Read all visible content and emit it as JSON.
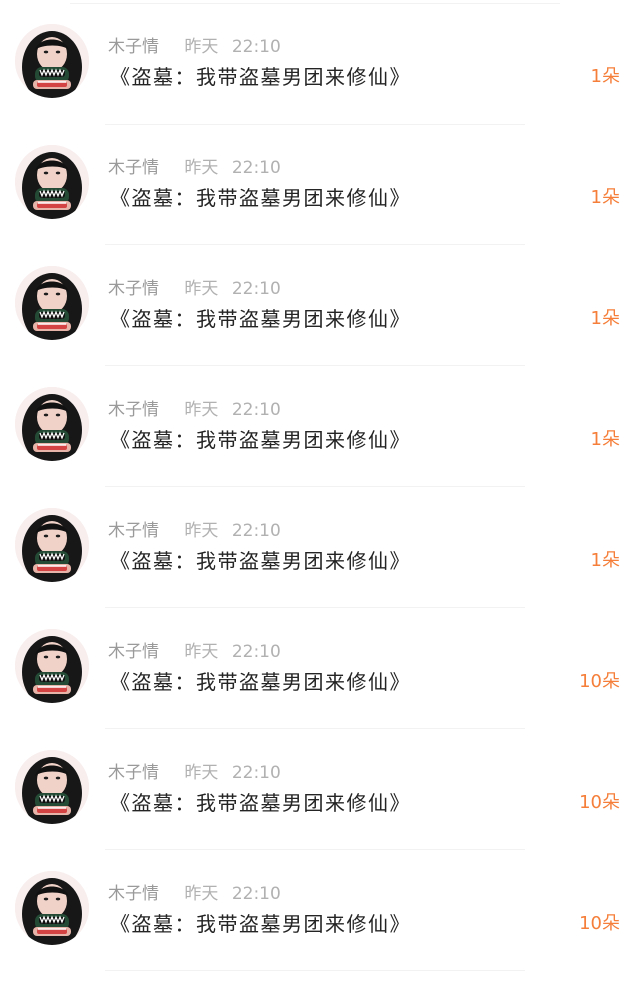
{
  "feed": {
    "items": [
      {
        "user": "木子情",
        "date": "昨天",
        "time": "22:10",
        "title": "《盗墓：我带盗墓男团来修仙》",
        "count": "1朵"
      },
      {
        "user": "木子情",
        "date": "昨天",
        "time": "22:10",
        "title": "《盗墓：我带盗墓男团来修仙》",
        "count": "1朵"
      },
      {
        "user": "木子情",
        "date": "昨天",
        "time": "22:10",
        "title": "《盗墓：我带盗墓男团来修仙》",
        "count": "1朵"
      },
      {
        "user": "木子情",
        "date": "昨天",
        "time": "22:10",
        "title": "《盗墓：我带盗墓男团来修仙》",
        "count": "1朵"
      },
      {
        "user": "木子情",
        "date": "昨天",
        "time": "22:10",
        "title": "《盗墓：我带盗墓男团来修仙》",
        "count": "1朵"
      },
      {
        "user": "木子情",
        "date": "昨天",
        "time": "22:10",
        "title": "《盗墓：我带盗墓男团来修仙》",
        "count": "10朵"
      },
      {
        "user": "木子情",
        "date": "昨天",
        "time": "22:10",
        "title": "《盗墓：我带盗墓男团来修仙》",
        "count": "10朵"
      },
      {
        "user": "木子情",
        "date": "昨天",
        "time": "22:10",
        "title": "《盗墓：我带盗墓男团来修仙》",
        "count": "10朵"
      }
    ]
  }
}
